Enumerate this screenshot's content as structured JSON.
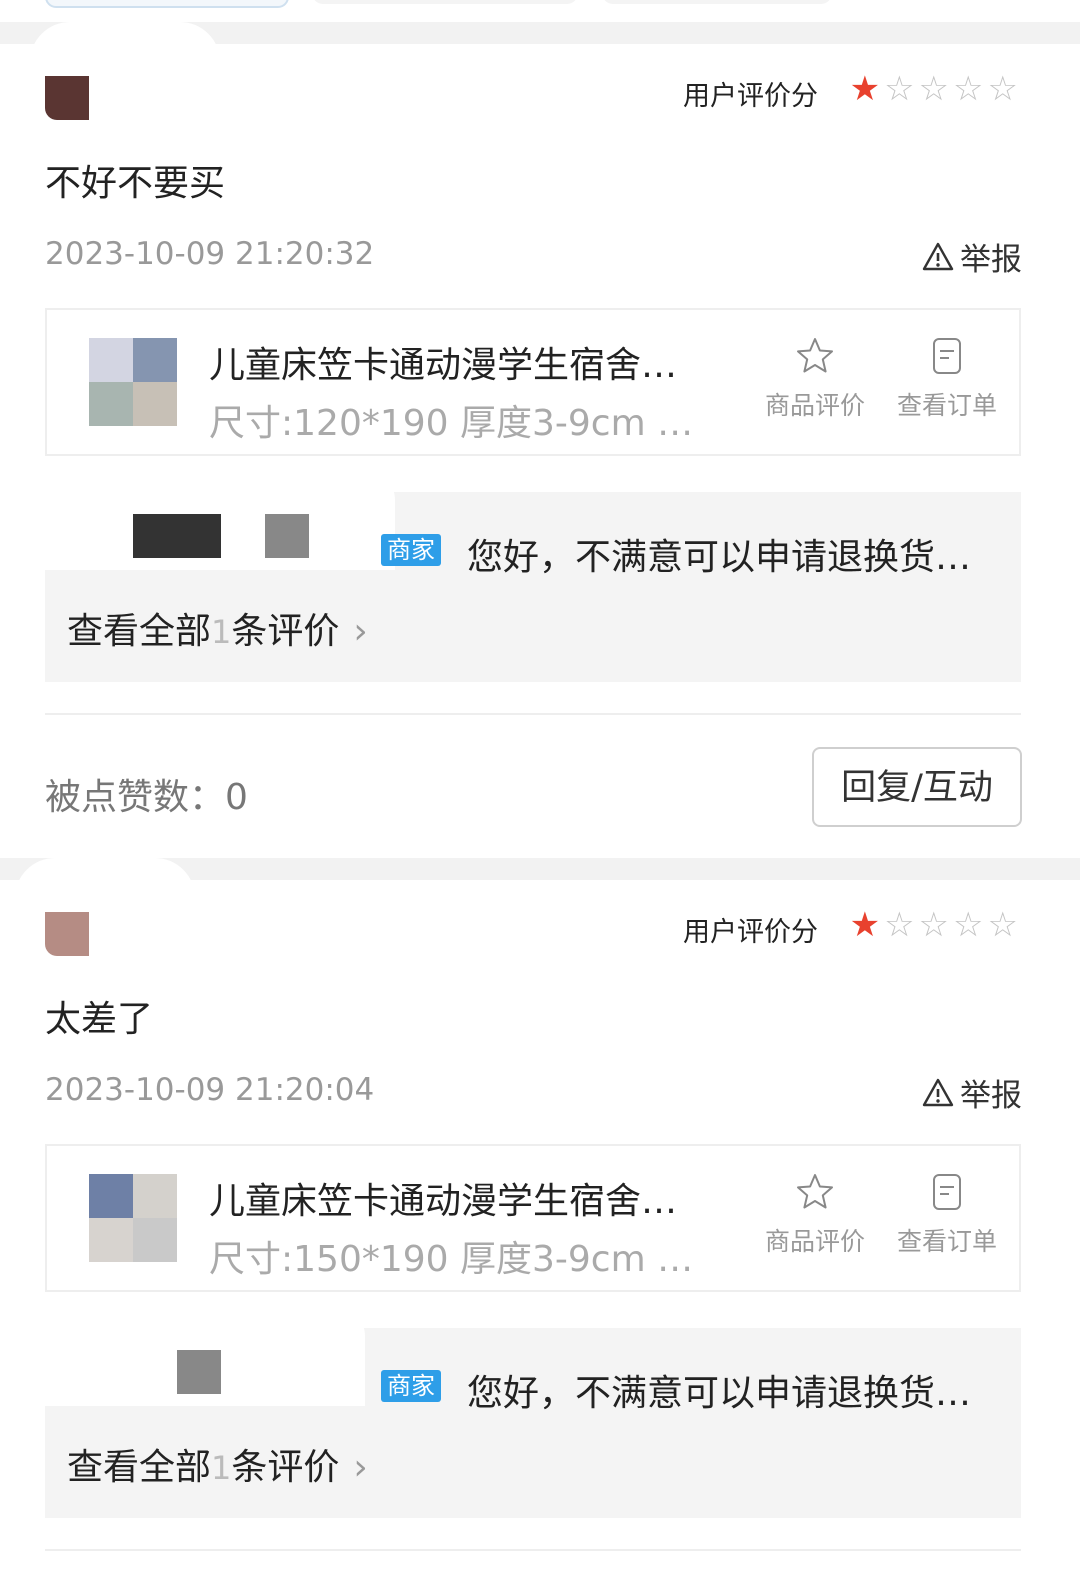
{
  "reviews": [
    {
      "score_label": "用户评价分",
      "rating": 1,
      "max_rating": 5,
      "avatar_color": "#5a3532",
      "text": "不好不要买",
      "time": "2023-10-09 21:20:32",
      "report_label": "举报",
      "product": {
        "name": "儿童床笠卡通动漫学生宿舍…",
        "spec": "尺寸:120*190 厚度3-9cm …",
        "thumb_colors": [
          "#d3d5e2",
          "#8595b0",
          "#a8b5b0",
          "#c7c0b6"
        ],
        "action_review_label": "商品评价",
        "action_order_label": "查看订单"
      },
      "merchant": {
        "tag": "商家",
        "reply": "您好，不满意可以申请退换货…",
        "view_all_prefix": "查看全部",
        "view_all_count": "1",
        "view_all_suffix": "条评价",
        "chevron": "›"
      },
      "likes_label": "被点赞数：0",
      "reply_button": "回复/互动"
    },
    {
      "score_label": "用户评价分",
      "rating": 1,
      "max_rating": 5,
      "avatar_color": "#b58c84",
      "text": "太差了",
      "time": "2023-10-09 21:20:04",
      "report_label": "举报",
      "product": {
        "name": "儿童床笠卡通动漫学生宿舍…",
        "spec": "尺寸:150*190 厚度3-9cm …",
        "thumb_colors": [
          "#6e80a6",
          "#d4d1cc",
          "#d7d3cf",
          "#c9c9c9"
        ],
        "action_review_label": "商品评价",
        "action_order_label": "查看订单"
      },
      "merchant": {
        "tag": "商家",
        "reply": "您好，不满意可以申请退换货…",
        "view_all_prefix": "查看全部",
        "view_all_count": "1",
        "view_all_suffix": "条评价",
        "chevron": "›"
      }
    }
  ]
}
